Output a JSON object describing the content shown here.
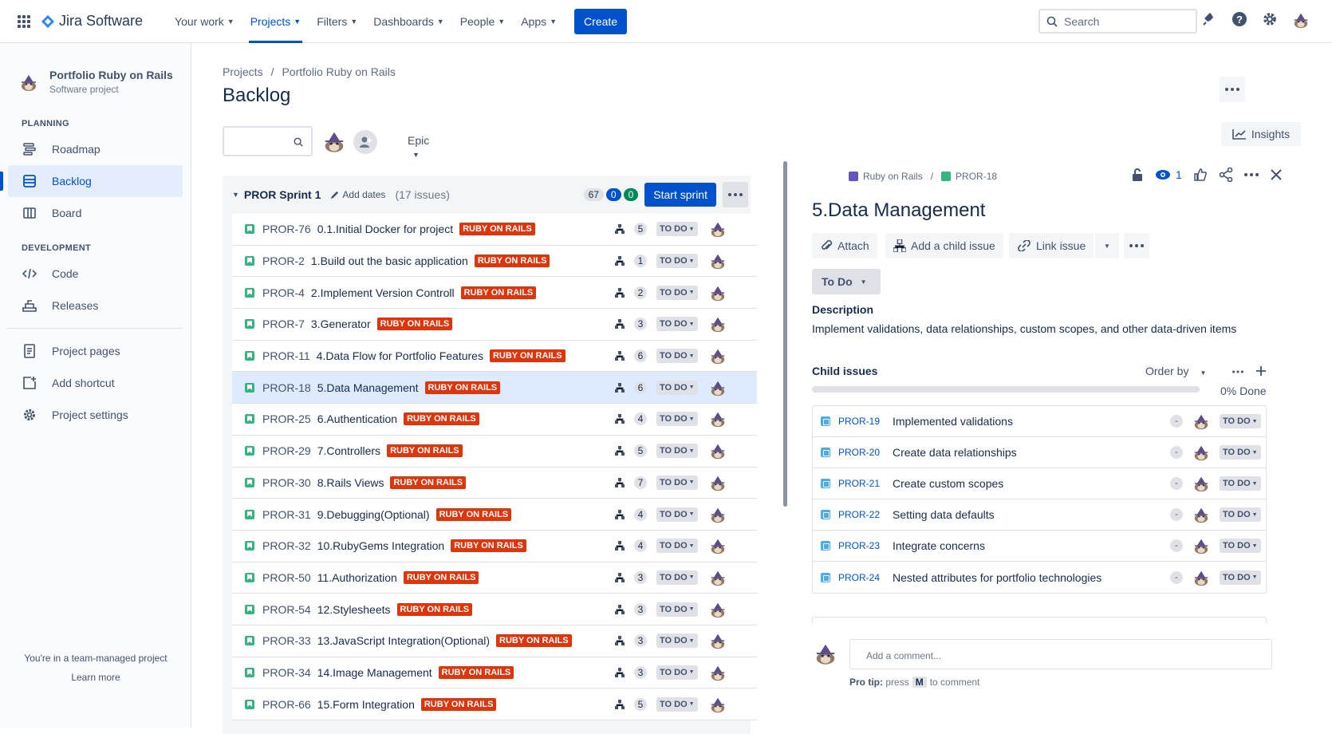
{
  "topnav": {
    "product": "Jira Software",
    "items": [
      {
        "label": "Your work"
      },
      {
        "label": "Projects"
      },
      {
        "label": "Filters"
      },
      {
        "label": "Dashboards"
      },
      {
        "label": "People"
      },
      {
        "label": "Apps"
      }
    ],
    "create": "Create",
    "search_placeholder": "Search"
  },
  "sidebar": {
    "project_name": "Portfolio Ruby on Rails",
    "project_type": "Software project",
    "planning_title": "PLANNING",
    "planning": [
      {
        "label": "Roadmap",
        "icon": "roadmap-icon"
      },
      {
        "label": "Backlog",
        "icon": "backlog-icon"
      },
      {
        "label": "Board",
        "icon": "board-icon"
      }
    ],
    "development_title": "DEVELOPMENT",
    "development": [
      {
        "label": "Code",
        "icon": "code-icon"
      },
      {
        "label": "Releases",
        "icon": "releases-icon"
      }
    ],
    "other": [
      {
        "label": "Project pages",
        "icon": "pages-icon"
      },
      {
        "label": "Add shortcut",
        "icon": "shortcut-icon"
      },
      {
        "label": "Project settings",
        "icon": "gear-icon"
      }
    ],
    "footer_text": "You're in a team-managed project",
    "footer_link": "Learn more"
  },
  "main": {
    "breadcrumb": [
      "Projects",
      "Portfolio Ruby on Rails"
    ],
    "title": "Backlog",
    "epic_filter": "Epic",
    "insights": "Insights"
  },
  "sprint": {
    "name": "PROR Sprint 1",
    "add_dates": "Add dates",
    "issue_count": "(17 issues)",
    "points_todo": "67",
    "points_inprogress": "0",
    "points_done": "0",
    "start_button": "Start sprint",
    "issues": [
      {
        "key": "PROR-76",
        "summary": "0.1.Initial Docker for project",
        "label": "RUBY ON RAILS",
        "children": "5",
        "status": "TO DO"
      },
      {
        "key": "PROR-2",
        "summary": "1.Build out the basic application",
        "label": "RUBY ON RAILS",
        "children": "1",
        "status": "TO DO"
      },
      {
        "key": "PROR-4",
        "summary": "2.Implement Version Controll",
        "label": "RUBY ON RAILS",
        "children": "2",
        "status": "TO DO"
      },
      {
        "key": "PROR-7",
        "summary": "3.Generator",
        "label": "RUBY ON RAILS",
        "children": "3",
        "status": "TO DO"
      },
      {
        "key": "PROR-11",
        "summary": "4.Data Flow for Portfolio Features",
        "label": "RUBY ON RAILS",
        "children": "6",
        "status": "TO DO"
      },
      {
        "key": "PROR-18",
        "summary": "5.Data Management",
        "label": "RUBY ON RAILS",
        "children": "6",
        "status": "TO DO"
      },
      {
        "key": "PROR-25",
        "summary": "6.Authentication",
        "label": "RUBY ON RAILS",
        "children": "4",
        "status": "TO DO"
      },
      {
        "key": "PROR-29",
        "summary": "7.Controllers",
        "label": "RUBY ON RAILS",
        "children": "5",
        "status": "TO DO"
      },
      {
        "key": "PROR-30",
        "summary": "8.Rails Views",
        "label": "RUBY ON RAILS",
        "children": "7",
        "status": "TO DO"
      },
      {
        "key": "PROR-31",
        "summary": "9.Debugging(Optional)",
        "label": "RUBY ON RAILS",
        "children": "4",
        "status": "TO DO"
      },
      {
        "key": "PROR-32",
        "summary": "10.RubyGems Integration",
        "label": "RUBY ON RAILS",
        "children": "4",
        "status": "TO DO"
      },
      {
        "key": "PROR-50",
        "summary": "11.Authorization",
        "label": "RUBY ON RAILS",
        "children": "3",
        "status": "TO DO"
      },
      {
        "key": "PROR-54",
        "summary": "12.Stylesheets",
        "label": "RUBY ON RAILS",
        "children": "3",
        "status": "TO DO"
      },
      {
        "key": "PROR-33",
        "summary": "13.JavaScript Integration(Optional)",
        "label": "RUBY ON RAILS",
        "children": "3",
        "status": "TO DO"
      },
      {
        "key": "PROR-34",
        "summary": "14.Image Management",
        "label": "RUBY ON RAILS",
        "children": "3",
        "status": "TO DO"
      },
      {
        "key": "PROR-66",
        "summary": "15.Form Integration",
        "label": "RUBY ON RAILS",
        "children": "5",
        "status": "TO DO"
      }
    ]
  },
  "detail": {
    "epic_crumb": "Ruby on Rails",
    "issue_crumb": "PROR-18",
    "watchers": "1",
    "title": "5.Data Management",
    "attach": "Attach",
    "add_child": "Add a child issue",
    "link_issue": "Link issue",
    "status": "To Do",
    "description_heading": "Description",
    "description": "Implement validations, data relationships, custom scopes, and other data-driven items",
    "child_heading": "Child issues",
    "order_by": "Order by",
    "done_text": "0% Done",
    "children": [
      {
        "key": "PROR-19",
        "summary": "Implemented validations",
        "status": "TO DO"
      },
      {
        "key": "PROR-20",
        "summary": "Create data relationships",
        "status": "TO DO"
      },
      {
        "key": "PROR-21",
        "summary": "Create custom scopes",
        "status": "TO DO"
      },
      {
        "key": "PROR-22",
        "summary": "Setting data defaults",
        "status": "TO DO"
      },
      {
        "key": "PROR-23",
        "summary": "Integrate concerns",
        "status": "TO DO"
      },
      {
        "key": "PROR-24",
        "summary": "Nested attributes for portfolio technologies",
        "status": "TO DO"
      }
    ],
    "comment_placeholder": "Add a comment...",
    "protip_prefix": "Pro tip:",
    "protip_press": "press",
    "protip_key": "M",
    "protip_suffix": "to comment"
  }
}
